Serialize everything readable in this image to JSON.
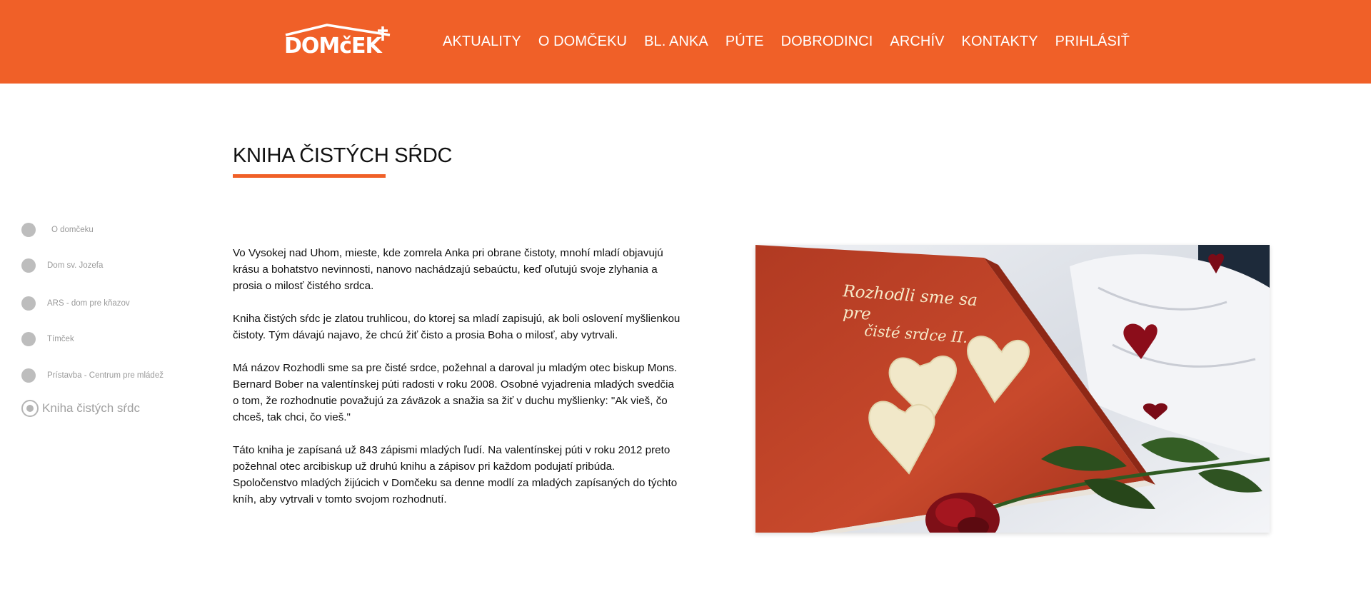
{
  "brand": {
    "logo_text": "DOMčEK",
    "accent_color": "#f06028"
  },
  "nav": {
    "items": [
      {
        "label": "AKTUALITY"
      },
      {
        "label": "O DOMČEKU"
      },
      {
        "label": "BL. ANKA"
      },
      {
        "label": "PÚTE"
      },
      {
        "label": "DOBRODINCI"
      },
      {
        "label": "ARCHÍV"
      },
      {
        "label": "KONTAKTY"
      },
      {
        "label": "PRIHLÁSIŤ"
      }
    ]
  },
  "page": {
    "title": "KNIHA ČISTÝCH SŔDC"
  },
  "sidebar": {
    "items": [
      {
        "label": "O domčeku",
        "active": false
      },
      {
        "label": "Dom sv. Jozefa",
        "active": false
      },
      {
        "label": "ARS - dom pre kňazov",
        "active": false
      },
      {
        "label": "Tímček",
        "active": false
      },
      {
        "label": "Prístavba - Centrum pre mládež",
        "active": false
      },
      {
        "label": "Kniha čistých sŕdc",
        "active": true
      }
    ]
  },
  "content": {
    "paragraphs": [
      "Vo Vysokej nad Uhom, mieste, kde zomrela Anka pri obrane čistoty, mnohí mladí objavujú krásu a bohatstvo nevinnosti, nanovo nachádzajú sebaúctu, keď oľutujú svoje zlyhania a prosia o milosť čistého srdca.",
      "Kniha čistých sŕdc je zlatou truhlicou, do ktorej sa mladí zapisujú, ak boli oslovení myšlienkou čistoty. Tým dávajú najavo, že chcú žiť čisto a prosia Boha o milosť, aby vytrvali.",
      "Má názov Rozhodli sme sa pre čisté srdce, požehnal a daroval ju mladým otec biskup Mons. Bernard Bober na valentínskej púti radosti v roku 2008. Osobné vyjadrenia mladých svedčia o tom, že rozhodnutie považujú za záväzok a snažia sa žiť v duchu myšlienky: \"Ak vieš, čo chceš, tak chci, čo vieš.\"",
      "Táto kniha je zapísaná už 843 zápismi mladých ľudí. Na valentínskej púti v roku 2012 preto požehnal otec arcibiskup už druhú knihu a zápisov pri každom podujatí pribúda. Spoločenstvo mladých žijúcich v Domčeku sa denne modlí za mladých zapísaných do týchto kníh, aby vytrvali v tomto svojom rozhodnutí."
    ]
  },
  "photo": {
    "book_lines": [
      "Rozhodli sme sa",
      "pre",
      "čisté srdce II."
    ]
  }
}
